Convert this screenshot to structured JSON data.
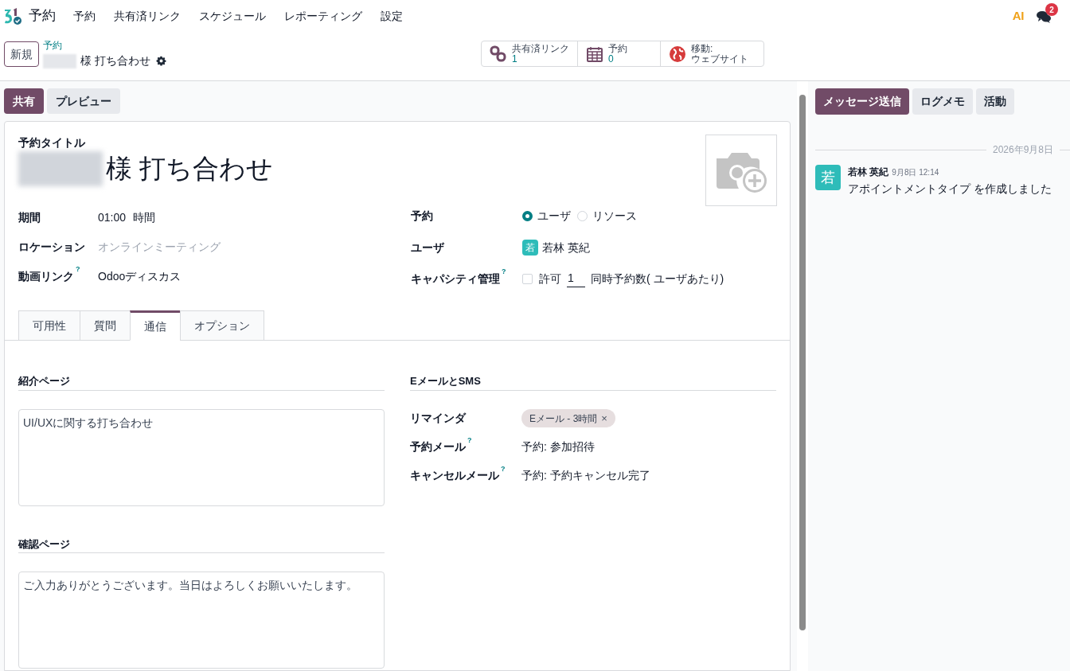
{
  "navbar": {
    "app_name": "予約",
    "menu": [
      {
        "label": "予約"
      },
      {
        "label": "共有済リンク"
      },
      {
        "label": "スケジュール"
      },
      {
        "label": "レポーティング"
      },
      {
        "label": "設定"
      }
    ],
    "ai_label": "AI",
    "message_count": "2"
  },
  "control_bar": {
    "new_button": "新規",
    "breadcrumb": "予約",
    "record_title": "様 打ち合わせ",
    "smart_buttons": [
      {
        "kind": "link",
        "label": "共有済リンク",
        "value": "1"
      },
      {
        "kind": "calendar",
        "label": "予約",
        "value": "0"
      },
      {
        "kind": "globe",
        "label": "移動:",
        "value": "ウェブサイト"
      }
    ]
  },
  "actions": [
    {
      "label": "共有",
      "primary": true
    },
    {
      "label": "プレビュー",
      "primary": false
    }
  ],
  "form": {
    "title_label": "予約タイトル",
    "title": "様 打ち合わせ",
    "left_fields": [
      {
        "label": "期間",
        "kind": "duration",
        "value": "01:00",
        "unit": "時間"
      },
      {
        "label": "ロケーション",
        "kind": "location",
        "placeholder": "オンラインミーティング"
      },
      {
        "label": "動画リンク",
        "help": "?",
        "kind": "text",
        "value": "Odooディスカス"
      }
    ],
    "schedule": {
      "label": "予約",
      "options": [
        {
          "label": "ユーザ",
          "selected": true
        },
        {
          "label": "リソース",
          "selected": false
        }
      ]
    },
    "user": {
      "label": "ユーザ",
      "avatar": "若",
      "name": "若林 英紀"
    },
    "capacity": {
      "label": "キャパシティ管理",
      "help": "?",
      "checked": false,
      "allow": "許可",
      "count": "1",
      "suffix": "同時予約数( ユーザあたり)"
    },
    "tabs": [
      {
        "label": "可用性",
        "selected": false
      },
      {
        "label": "質問",
        "selected": false
      },
      {
        "label": "通信",
        "selected": true
      },
      {
        "label": "オプション",
        "selected": false
      }
    ],
    "intro": {
      "heading": "紹介ページ",
      "text": "UI/UXに関する打ち合わせ"
    },
    "confirm": {
      "heading": "確認ページ",
      "text": "ご入力ありがとうございます。当日はよろしくお願いいたします。"
    },
    "email_sms": {
      "heading": "EメールとSMS",
      "reminder_label": "リマインダ",
      "reminder_tag": "Eメール - 3時間",
      "reminder_remove": "×",
      "rows": [
        {
          "label": "予約メール",
          "help": "?",
          "value": "予約: 参加招待"
        },
        {
          "label": "キャンセルメール",
          "help": "?",
          "value": "予約: 予約キャンセル完了"
        }
      ]
    }
  },
  "chatter": {
    "buttons": [
      {
        "label": "メッセージ送信",
        "primary": true
      },
      {
        "label": "ログメモ",
        "primary": false
      },
      {
        "label": "活動",
        "primary": false
      }
    ],
    "date": "2026年9月8日",
    "messages": [
      {
        "avatar": "若",
        "author": "若林 英紀",
        "time": "9月8日 12:14",
        "body": "アポイントメントタイプ を作成しました"
      }
    ]
  }
}
